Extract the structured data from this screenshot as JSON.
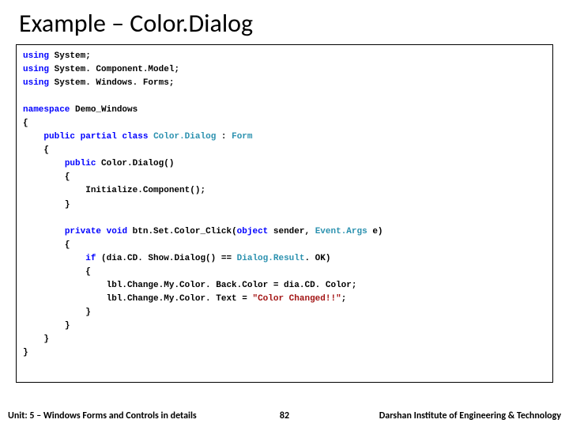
{
  "title": "Example – Color.Dialog",
  "code": {
    "u1a": "using",
    "u1b": " System;",
    "u2a": "using",
    "u2b": " System. Component.Model;",
    "u3a": "using",
    "u3b": " System. Windows. Forms;",
    "ns": "namespace",
    "nsName": " Demo_Windows",
    "lb": "{",
    "rb": "}",
    "pub": "public",
    "par": "partial",
    "clsKw": "class",
    "clsName": "Color.Dialog",
    "col": " : ",
    "form": "Form",
    "ctor": " Color.Dialog()",
    "init": "Initialize.Component();",
    "priv": "private",
    "vd": "void",
    "btn": " btn.Set.Color_Click(",
    "obj": "object",
    "snd": " sender, ",
    "ea": "Event.Args",
    "eParen": " e)",
    "ifKw": "if",
    "ifCond": " (dia.CD. Show.Dialog() == ",
    "dlg": "Dialog.Result",
    "ok": ". OK)",
    "l1": "lbl.Change.My.Color. Back.Color = dia.CD. Color;",
    "l2a": "lbl.Change.My.Color. Text = ",
    "l2b": "\"Color Changed!!\"",
    "l2c": ";"
  },
  "footer": {
    "unit": "Unit: 5 – Windows Forms and Controls in details",
    "page": "82",
    "inst": "Darshan Institute of Engineering & Technology"
  }
}
